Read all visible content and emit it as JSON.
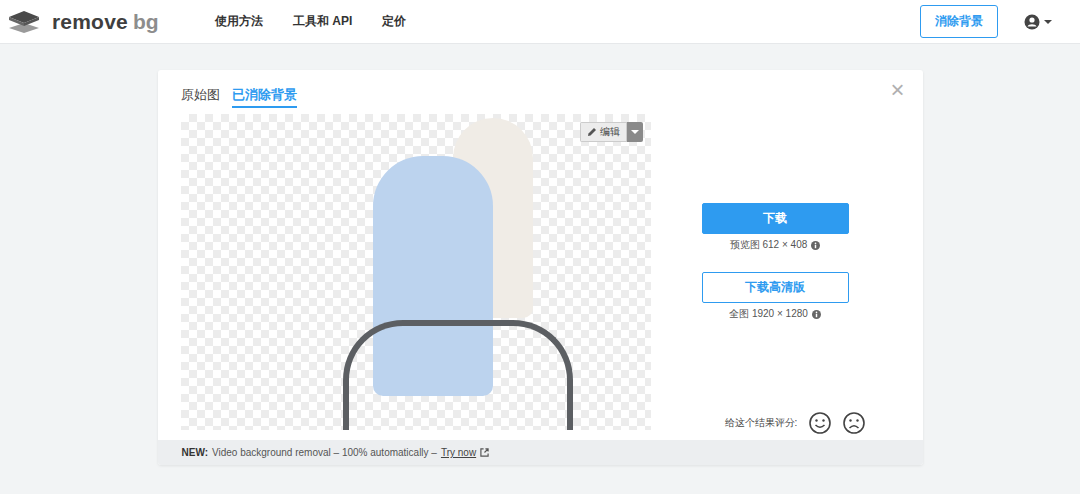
{
  "header": {
    "logo": {
      "word": "remove",
      "suffix": "bg"
    },
    "nav": [
      "使用方法",
      "工具和 API",
      "定价"
    ],
    "cta": "消除背景"
  },
  "tabs": [
    {
      "label": "原始图",
      "selected": false
    },
    {
      "label": "已消除背景",
      "selected": true
    }
  ],
  "close": "×",
  "editor": {
    "edit_label": "编辑"
  },
  "downloads": [
    {
      "label": "下载",
      "kind": "filled",
      "caption": "预览图 612 × 408"
    },
    {
      "label": "下载高清版",
      "kind": "outline",
      "caption": "全图 1920 × 1280"
    }
  ],
  "rating": {
    "label": "给这个结果评分:"
  },
  "footer": {
    "badge": "NEW:",
    "text": "Video background removal – 100% automatically –",
    "link": "Try now"
  }
}
